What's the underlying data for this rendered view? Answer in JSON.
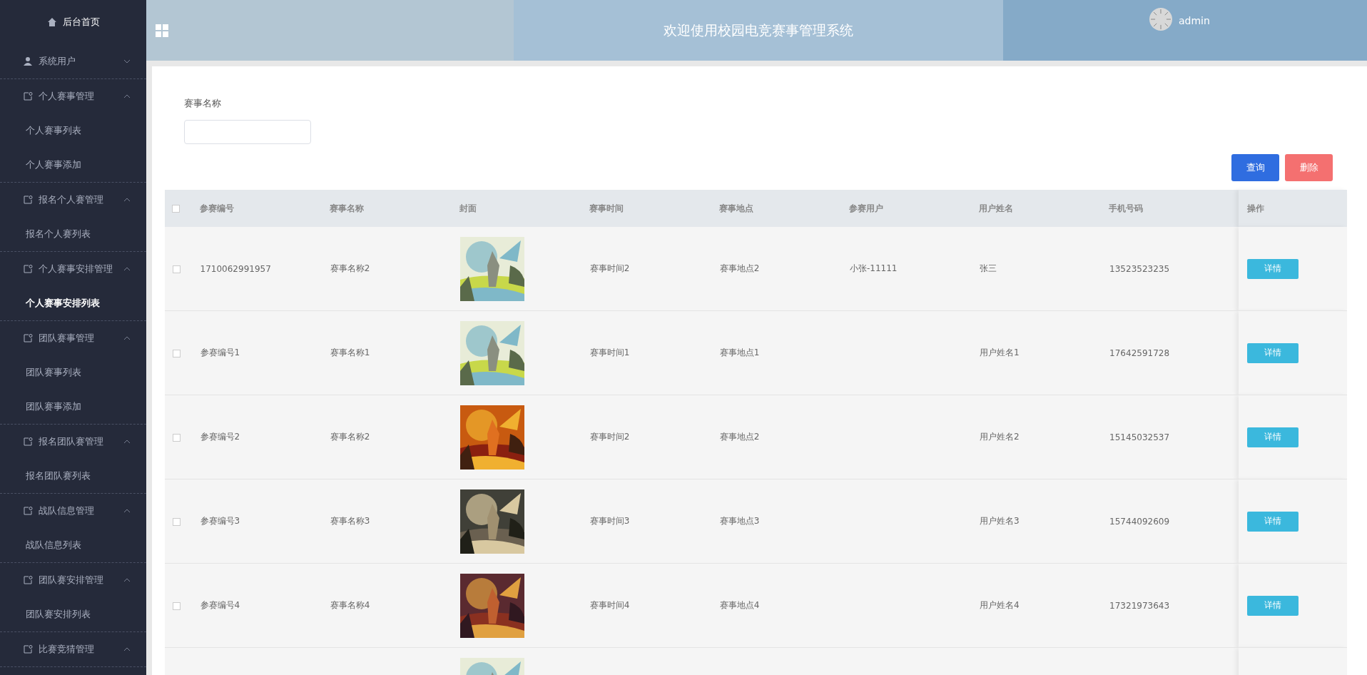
{
  "sidebar": {
    "home": "后台首页",
    "groups": [
      {
        "label": "系统用户",
        "expanded": false
      },
      {
        "label": "个人赛事管理",
        "expanded": true,
        "children": [
          {
            "label": "个人赛事列表",
            "selected": false
          },
          {
            "label": "个人赛事添加",
            "selected": false
          }
        ]
      },
      {
        "label": "报名个人赛管理",
        "expanded": true,
        "children": [
          {
            "label": "报名个人赛列表",
            "selected": false
          }
        ]
      },
      {
        "label": "个人赛事安排管理",
        "expanded": true,
        "children": [
          {
            "label": "个人赛事安排列表",
            "selected": true
          }
        ]
      },
      {
        "label": "团队赛事管理",
        "expanded": true,
        "children": [
          {
            "label": "团队赛事列表",
            "selected": false
          },
          {
            "label": "团队赛事添加",
            "selected": false
          }
        ]
      },
      {
        "label": "报名团队赛管理",
        "expanded": true,
        "children": [
          {
            "label": "报名团队赛列表",
            "selected": false
          }
        ]
      },
      {
        "label": "战队信息管理",
        "expanded": true,
        "children": [
          {
            "label": "战队信息列表",
            "selected": false
          }
        ]
      },
      {
        "label": "团队赛安排管理",
        "expanded": true,
        "children": [
          {
            "label": "团队赛安排列表",
            "selected": false
          }
        ]
      },
      {
        "label": "比赛竞猜管理",
        "expanded": true
      }
    ]
  },
  "header": {
    "title": "欢迎使用校园电竞赛事管理系统",
    "user": "admin"
  },
  "search": {
    "label": "赛事名称"
  },
  "buttons": [
    {
      "label": "查询",
      "kind": "primary"
    },
    {
      "label": "删除",
      "kind": "danger"
    }
  ],
  "table": {
    "select_all": {
      "checked": false
    },
    "columns": [
      "参赛编号",
      "赛事名称",
      "封面",
      "赛事时间",
      "赛事地点",
      "参赛用户",
      "用户姓名",
      "手机号码",
      "操作"
    ],
    "rows": [
      {
        "checked": false,
        "entry_no": "1710062991957",
        "event_name": "赛事名称2",
        "cover": {
          "kind": "picture"
        },
        "event_time": "赛事时间2",
        "event_place": "赛事地点2",
        "player": "小张-11111",
        "user_name": "张三",
        "phone": "13523523235",
        "action": "详情"
      },
      {
        "checked": false,
        "entry_no": "参赛编号1",
        "event_name": "赛事名称1",
        "cover": {
          "kind": "picture"
        },
        "event_time": "赛事时间1",
        "event_place": "赛事地点1",
        "user_name": "用户姓名1",
        "phone": "17642591728",
        "action": "详情"
      },
      {
        "checked": false,
        "entry_no": "参赛编号2",
        "event_name": "赛事名称2",
        "cover": {
          "kind": "picture"
        },
        "event_time": "赛事时间2",
        "event_place": "赛事地点2",
        "user_name": "用户姓名2",
        "phone": "15145032537",
        "action": "详情"
      },
      {
        "checked": false,
        "entry_no": "参赛编号3",
        "event_name": "赛事名称3",
        "cover": {
          "kind": "picture"
        },
        "event_time": "赛事时间3",
        "event_place": "赛事地点3",
        "user_name": "用户姓名3",
        "phone": "15744092609",
        "action": "详情"
      },
      {
        "checked": false,
        "entry_no": "参赛编号4",
        "event_name": "赛事名称4",
        "cover": {
          "kind": "picture"
        },
        "event_time": "赛事时间4",
        "event_place": "赛事地点4",
        "user_name": "用户姓名4",
        "phone": "17321973643",
        "action": "详情"
      },
      {
        "cover": {
          "kind": "picture"
        }
      }
    ]
  }
}
